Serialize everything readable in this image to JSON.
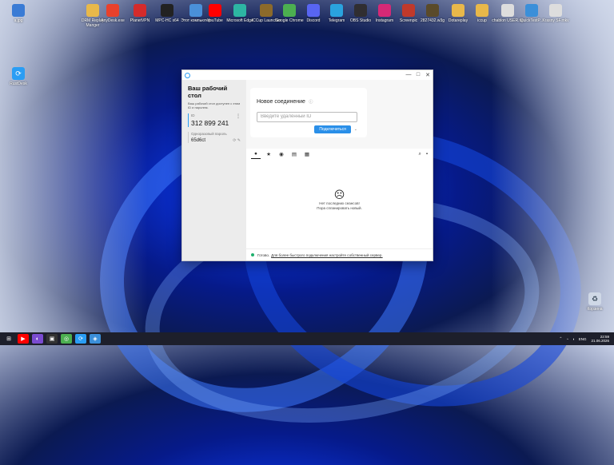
{
  "desktop": {
    "top_icons": [
      {
        "label": "a.jpg",
        "icon": "image-file-icon",
        "color": "#3a7bd5"
      },
      {
        "label": "DRM Replay Manger",
        "icon": "folder-icon",
        "color": "#e8b84a"
      },
      {
        "label": "AnyDesk.exe",
        "icon": "anydesk-icon",
        "color": "#e8412c"
      },
      {
        "label": "PlanetVPN",
        "icon": "vpn-icon",
        "color": "#d42b2b"
      },
      {
        "label": "MPC-HC x64",
        "icon": "video-player-icon",
        "color": "#222222"
      },
      {
        "label": "Этот компьютер",
        "icon": "computer-icon",
        "color": "#4a90d9"
      },
      {
        "label": "YouTube",
        "icon": "youtube-icon",
        "color": "#ff0000"
      },
      {
        "label": "Microsoft Edge",
        "icon": "edge-icon",
        "color": "#2db6a3"
      },
      {
        "label": "ICCup Launcher",
        "icon": "iccup-icon",
        "color": "#8c6a2b"
      },
      {
        "label": "Google Chrome",
        "icon": "chrome-icon",
        "color": "#4caf50"
      },
      {
        "label": "Discord",
        "icon": "discord-icon",
        "color": "#5865f2"
      },
      {
        "label": "Telegram",
        "icon": "telegram-icon",
        "color": "#2aa3de"
      },
      {
        "label": "OBS Studio",
        "icon": "obs-icon",
        "color": "#302e31"
      },
      {
        "label": "Instagram",
        "icon": "instagram-icon",
        "color": "#d62976"
      },
      {
        "label": "Screenpic",
        "icon": "screenpic-icon",
        "color": "#c0392b"
      },
      {
        "label": "2827432.w3g",
        "icon": "warcraft-file-icon",
        "color": "#5a4a2a"
      },
      {
        "label": "Dotareplay",
        "icon": "folder-icon",
        "color": "#e8b84a"
      },
      {
        "label": "iccup",
        "icon": "folder-icon",
        "color": "#e8b84a"
      },
      {
        "label": "chablon USER.txt",
        "icon": "text-file-icon",
        "color": "#dddddd"
      },
      {
        "label": "QuickTestP...",
        "icon": "quicktest-icon",
        "color": "#3b8fd9"
      },
      {
        "label": "Krasny SF.mkv",
        "icon": "video-file-icon",
        "color": "#dddddd"
      }
    ],
    "rustdesk_icon": {
      "label": "RustDesk",
      "icon": "rustdesk-icon",
      "color": "#2a9df4"
    },
    "recycle_bin": {
      "label": "Корзина",
      "icon": "recycle-bin-icon",
      "color": "#cfd8e6"
    }
  },
  "window": {
    "controls": {
      "minimize": "—",
      "maximize": "□",
      "close": "✕"
    },
    "left": {
      "title": "Ваш рабочий стол",
      "description": "Ваш рабочий стол доступен с этим ID и паролем.",
      "id_caption": "ID",
      "id_value": "312 899 241",
      "password_caption": "Одноразовый пароль",
      "password_value": "65d6ct"
    },
    "connect_card": {
      "title": "Новое соединение",
      "input_placeholder": "Введите удалённый ID",
      "connect_button": "Подключиться"
    },
    "empty_state": {
      "line1": "Нет последних сеансов!",
      "line2": "Пора спланировать новый."
    },
    "status": {
      "ready": "Готово.",
      "link": "Для более быстрого подключения настройте собственный сервер."
    }
  },
  "taskbar": {
    "lang": "ENG",
    "time": "22:59",
    "date": "21.06.2026"
  }
}
